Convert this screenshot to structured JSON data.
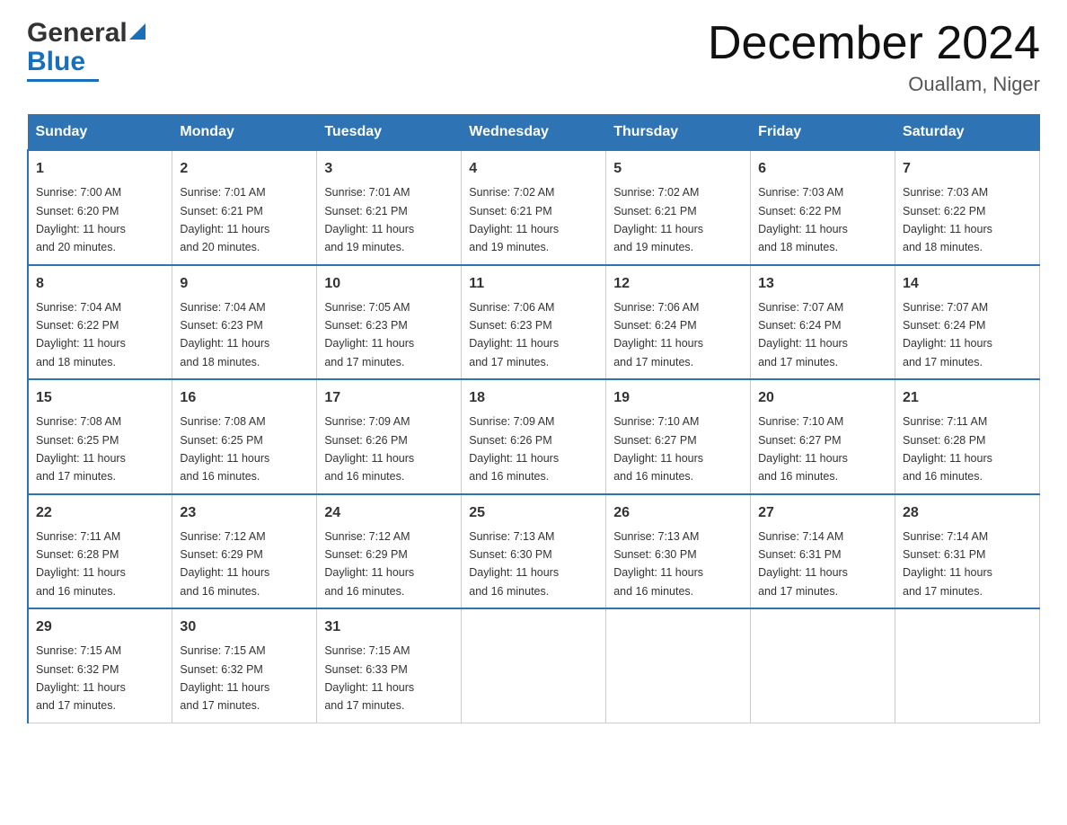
{
  "header": {
    "logo_general": "General",
    "logo_blue": "Blue",
    "month_title": "December 2024",
    "location": "Ouallam, Niger"
  },
  "days_of_week": [
    "Sunday",
    "Monday",
    "Tuesday",
    "Wednesday",
    "Thursday",
    "Friday",
    "Saturday"
  ],
  "weeks": [
    [
      {
        "day": "1",
        "sunrise": "7:00 AM",
        "sunset": "6:20 PM",
        "daylight": "11 hours and 20 minutes."
      },
      {
        "day": "2",
        "sunrise": "7:01 AM",
        "sunset": "6:21 PM",
        "daylight": "11 hours and 20 minutes."
      },
      {
        "day": "3",
        "sunrise": "7:01 AM",
        "sunset": "6:21 PM",
        "daylight": "11 hours and 19 minutes."
      },
      {
        "day": "4",
        "sunrise": "7:02 AM",
        "sunset": "6:21 PM",
        "daylight": "11 hours and 19 minutes."
      },
      {
        "day": "5",
        "sunrise": "7:02 AM",
        "sunset": "6:21 PM",
        "daylight": "11 hours and 19 minutes."
      },
      {
        "day": "6",
        "sunrise": "7:03 AM",
        "sunset": "6:22 PM",
        "daylight": "11 hours and 18 minutes."
      },
      {
        "day": "7",
        "sunrise": "7:03 AM",
        "sunset": "6:22 PM",
        "daylight": "11 hours and 18 minutes."
      }
    ],
    [
      {
        "day": "8",
        "sunrise": "7:04 AM",
        "sunset": "6:22 PM",
        "daylight": "11 hours and 18 minutes."
      },
      {
        "day": "9",
        "sunrise": "7:04 AM",
        "sunset": "6:23 PM",
        "daylight": "11 hours and 18 minutes."
      },
      {
        "day": "10",
        "sunrise": "7:05 AM",
        "sunset": "6:23 PM",
        "daylight": "11 hours and 17 minutes."
      },
      {
        "day": "11",
        "sunrise": "7:06 AM",
        "sunset": "6:23 PM",
        "daylight": "11 hours and 17 minutes."
      },
      {
        "day": "12",
        "sunrise": "7:06 AM",
        "sunset": "6:24 PM",
        "daylight": "11 hours and 17 minutes."
      },
      {
        "day": "13",
        "sunrise": "7:07 AM",
        "sunset": "6:24 PM",
        "daylight": "11 hours and 17 minutes."
      },
      {
        "day": "14",
        "sunrise": "7:07 AM",
        "sunset": "6:24 PM",
        "daylight": "11 hours and 17 minutes."
      }
    ],
    [
      {
        "day": "15",
        "sunrise": "7:08 AM",
        "sunset": "6:25 PM",
        "daylight": "11 hours and 17 minutes."
      },
      {
        "day": "16",
        "sunrise": "7:08 AM",
        "sunset": "6:25 PM",
        "daylight": "11 hours and 16 minutes."
      },
      {
        "day": "17",
        "sunrise": "7:09 AM",
        "sunset": "6:26 PM",
        "daylight": "11 hours and 16 minutes."
      },
      {
        "day": "18",
        "sunrise": "7:09 AM",
        "sunset": "6:26 PM",
        "daylight": "11 hours and 16 minutes."
      },
      {
        "day": "19",
        "sunrise": "7:10 AM",
        "sunset": "6:27 PM",
        "daylight": "11 hours and 16 minutes."
      },
      {
        "day": "20",
        "sunrise": "7:10 AM",
        "sunset": "6:27 PM",
        "daylight": "11 hours and 16 minutes."
      },
      {
        "day": "21",
        "sunrise": "7:11 AM",
        "sunset": "6:28 PM",
        "daylight": "11 hours and 16 minutes."
      }
    ],
    [
      {
        "day": "22",
        "sunrise": "7:11 AM",
        "sunset": "6:28 PM",
        "daylight": "11 hours and 16 minutes."
      },
      {
        "day": "23",
        "sunrise": "7:12 AM",
        "sunset": "6:29 PM",
        "daylight": "11 hours and 16 minutes."
      },
      {
        "day": "24",
        "sunrise": "7:12 AM",
        "sunset": "6:29 PM",
        "daylight": "11 hours and 16 minutes."
      },
      {
        "day": "25",
        "sunrise": "7:13 AM",
        "sunset": "6:30 PM",
        "daylight": "11 hours and 16 minutes."
      },
      {
        "day": "26",
        "sunrise": "7:13 AM",
        "sunset": "6:30 PM",
        "daylight": "11 hours and 16 minutes."
      },
      {
        "day": "27",
        "sunrise": "7:14 AM",
        "sunset": "6:31 PM",
        "daylight": "11 hours and 17 minutes."
      },
      {
        "day": "28",
        "sunrise": "7:14 AM",
        "sunset": "6:31 PM",
        "daylight": "11 hours and 17 minutes."
      }
    ],
    [
      {
        "day": "29",
        "sunrise": "7:15 AM",
        "sunset": "6:32 PM",
        "daylight": "11 hours and 17 minutes."
      },
      {
        "day": "30",
        "sunrise": "7:15 AM",
        "sunset": "6:32 PM",
        "daylight": "11 hours and 17 minutes."
      },
      {
        "day": "31",
        "sunrise": "7:15 AM",
        "sunset": "6:33 PM",
        "daylight": "11 hours and 17 minutes."
      },
      null,
      null,
      null,
      null
    ]
  ],
  "labels": {
    "sunrise": "Sunrise:",
    "sunset": "Sunset:",
    "daylight": "Daylight:"
  }
}
